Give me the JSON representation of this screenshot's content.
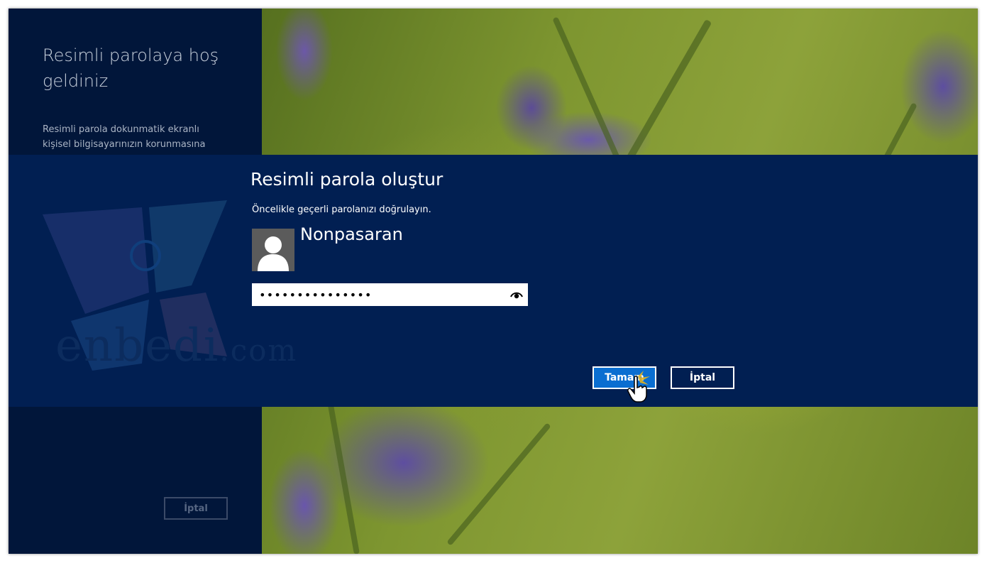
{
  "left_panel": {
    "title": "Resimli parolaya hoş geldiniz",
    "body": "Resimli parola dokunmatik ekranlı kişisel bilgisayarınızın korunmasına yardımcı",
    "cancel_label": "İptal"
  },
  "dialog": {
    "title": "Resimli parola oluştur",
    "subtitle": "Öncelikle geçerli parolanızı doğrulayın.",
    "username": "Nonpasaran",
    "password_value": "•••••••••••••••",
    "ok_label": "Tamam",
    "cancel_label": "İptal"
  },
  "watermark": {
    "brand": "enbedi",
    "suffix": ".com"
  },
  "icons": {
    "avatar": "user-silhouette-icon",
    "reveal": "eye-icon",
    "pointer": "hand-cursor-icon"
  },
  "colors": {
    "band": "#011f52",
    "left_panel": "#01163a",
    "ok_button": "#0a6ed1"
  }
}
